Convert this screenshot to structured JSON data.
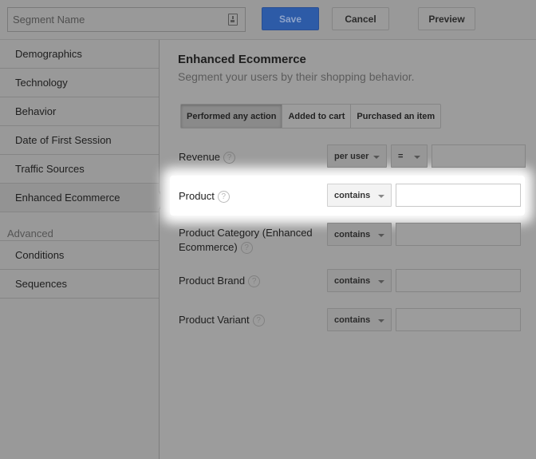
{
  "toolbar": {
    "segment_name_placeholder": "Segment Name",
    "segment_name_icon": "contact-card-icon",
    "save_label": "Save",
    "cancel_label": "Cancel",
    "preview_label": "Preview",
    "accent_color": "#2d5ba7"
  },
  "sidebar": {
    "items": [
      {
        "label": "Demographics"
      },
      {
        "label": "Technology"
      },
      {
        "label": "Behavior"
      },
      {
        "label": "Date of First Session"
      },
      {
        "label": "Traffic Sources"
      },
      {
        "label": "Enhanced Ecommerce",
        "active": true
      }
    ],
    "advanced_heading": "Advanced",
    "advanced_items": [
      {
        "label": "Conditions"
      },
      {
        "label": "Sequences"
      }
    ]
  },
  "main": {
    "title": "Enhanced Ecommerce",
    "subtitle": "Segment your users by their shopping behavior.",
    "tabs": [
      {
        "label": "Performed any action",
        "active": true
      },
      {
        "label": "Added to cart"
      },
      {
        "label": "Purchased an item"
      }
    ],
    "help_glyph": "?",
    "rows": [
      {
        "label": "Revenue",
        "scope": "per user",
        "operator": "=",
        "value": ""
      },
      {
        "label": "Product",
        "operator": "contains",
        "value": "",
        "highlighted": true
      },
      {
        "label": "Product Category (Enhanced Ecommerce)",
        "operator": "contains",
        "value": ""
      },
      {
        "label": "Product Brand",
        "operator": "contains",
        "value": ""
      },
      {
        "label": "Product Variant",
        "operator": "contains",
        "value": ""
      }
    ]
  }
}
